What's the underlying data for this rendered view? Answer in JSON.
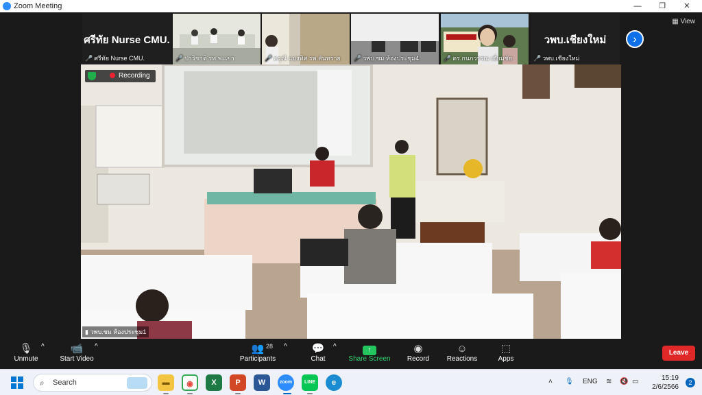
{
  "window": {
    "title": "Zoom Meeting",
    "controls": [
      "—",
      "❐",
      "✕"
    ]
  },
  "gallery": {
    "view_label": "View",
    "next_icon": "chevron-right-icon",
    "tiles": [
      {
        "display": "ศรีทัย Nurse  CMU.",
        "name": "ศรีทัย Nurse CMU.",
        "muted": true,
        "video": false
      },
      {
        "display": "",
        "name": "ปาริชาติ รพ.พะเยา",
        "muted": true,
        "video": true
      },
      {
        "display": "",
        "name": "ดรุณี แบ่งทิศ รพ.สันทราย",
        "muted": true,
        "video": true
      },
      {
        "display": "",
        "name": "วพบ.ชม ห้องประชุม4",
        "muted": true,
        "video": true
      },
      {
        "display": "",
        "name": "ดร.กนกวรรณ เอี่ยมชัย",
        "muted": true,
        "video": true
      },
      {
        "display": "วพบ.เชียงใหม่",
        "name": "วพบ.เชียงใหม่",
        "muted": true,
        "video": false
      }
    ]
  },
  "main_video": {
    "recording_label": "Recording",
    "speaker_name": "วพบ.ชม ห้องประชุม1"
  },
  "toolbar": {
    "unmute": "Unmute",
    "start_video": "Start Video",
    "participants": "Participants",
    "participants_count": "28",
    "chat": "Chat",
    "share_screen": "Share Screen",
    "record": "Record",
    "reactions": "Reactions",
    "apps": "Apps",
    "leave": "Leave",
    "share_color": "#22c55e",
    "leave_color": "#e02828"
  },
  "taskbar": {
    "search_placeholder": "Search",
    "apps": [
      {
        "name": "file-explorer",
        "glyph": "▬",
        "color": "#f4c542"
      },
      {
        "name": "chrome",
        "glyph": "◉",
        "color": "#e8453c"
      },
      {
        "name": "excel",
        "glyph": "X",
        "color": "#1d7a45"
      },
      {
        "name": "powerpoint",
        "glyph": "P",
        "color": "#d24726"
      },
      {
        "name": "word",
        "glyph": "W",
        "color": "#2b5797"
      },
      {
        "name": "zoom",
        "glyph": "zoom",
        "color": "#2d8cff"
      },
      {
        "name": "line",
        "glyph": "LINE",
        "color": "#06c755"
      },
      {
        "name": "edge",
        "glyph": "e",
        "color": "#1b8bd2"
      }
    ],
    "tray": {
      "lang": "ENG",
      "time": "15:19",
      "date": "2/6/2566",
      "notifications": "2"
    }
  }
}
